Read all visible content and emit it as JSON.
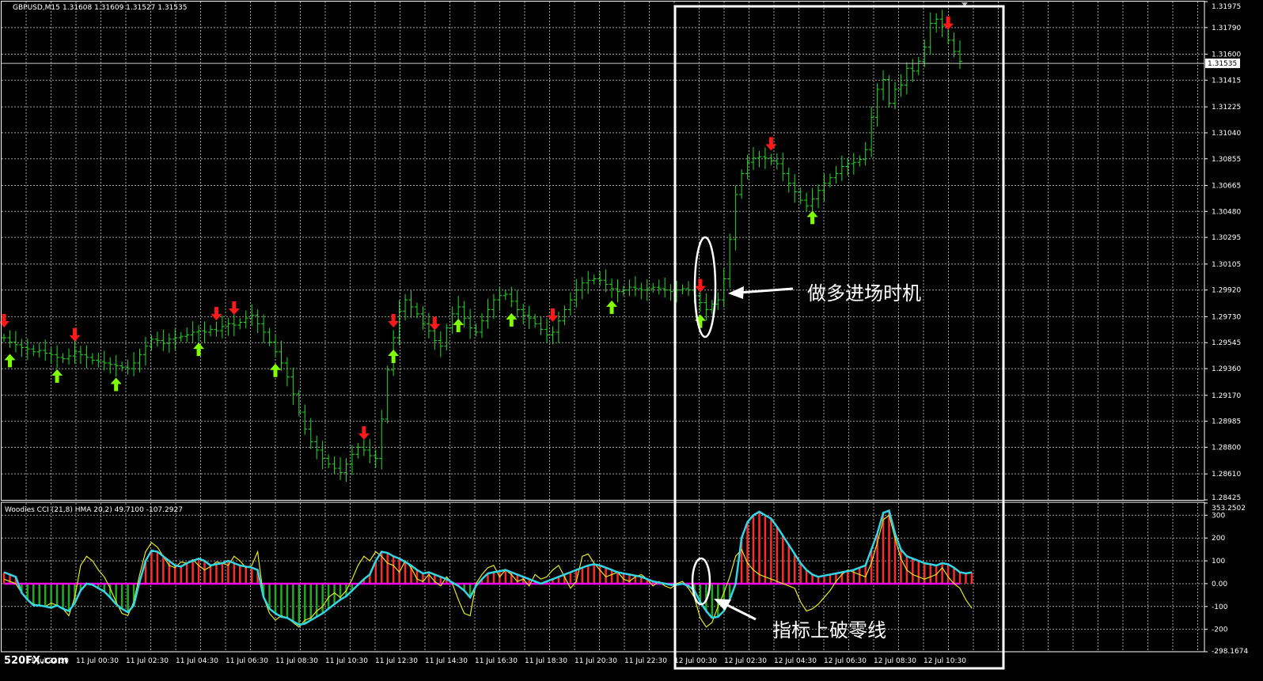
{
  "window": {
    "symbol_label": "GBPUSD,M15",
    "ohlc_label": "1.31608 1.31609 1.31527 1.31535",
    "indicator_label": "Woodies CCI (21,8) HMA 20,2) 49.7100 -107.2927",
    "watermark": "520FX.com"
  },
  "annotations": {
    "long_entry": "做多进场时机",
    "zero_break": "指标上破零线"
  },
  "colors": {
    "background": "#000000",
    "grid": "#a0a0a0",
    "price_bar": "#22dd22",
    "up_arrow": "#7fff00",
    "down_arrow": "#ff1a1a",
    "cci_line": "#33d6e6",
    "turbo_line": "#e6e619",
    "zero_line": "#ff00ff",
    "hist_up": "#ff2a2a",
    "hist_down": "#22aa22",
    "highlight_box": "#ffffff"
  },
  "chart_data": {
    "type": "line",
    "price": {
      "last": "1.31535",
      "ylim": [
        1.28425,
        1.31975
      ],
      "ticks": [
        "1.31975",
        "1.31790",
        "1.31600",
        "1.31415",
        "1.31225",
        "1.31040",
        "1.30855",
        "1.30665",
        "1.30480",
        "1.30295",
        "1.30105",
        "1.29920",
        "1.29730",
        "1.29545",
        "1.29360",
        "1.29170",
        "1.28985",
        "1.28800",
        "1.28610",
        "1.28425"
      ],
      "closes": [
        1.2958,
        1.2955,
        1.2953,
        1.2951,
        1.295,
        1.2948,
        1.2949,
        1.2947,
        1.2946,
        1.2944,
        1.2943,
        1.2945,
        1.2948,
        1.2946,
        1.2944,
        1.2942,
        1.2941,
        1.294,
        1.2939,
        1.2938,
        1.2937,
        1.2936,
        1.294,
        1.2946,
        1.2952,
        1.2957,
        1.2956,
        1.2954,
        1.2957,
        1.2958,
        1.2959,
        1.296,
        1.2962,
        1.2963,
        1.2962,
        1.2964,
        1.2963,
        1.2966,
        1.2968,
        1.2967,
        1.2969,
        1.2972,
        1.2974,
        1.2968,
        1.2962,
        1.2955,
        1.2948,
        1.294,
        1.293,
        1.2918,
        1.2905,
        1.2893,
        1.2884,
        1.2878,
        1.2872,
        1.2868,
        1.2865,
        1.2862,
        1.2868,
        1.2875,
        1.288,
        1.2878,
        1.2874,
        1.2872,
        1.29,
        1.2935,
        1.2958,
        1.2977,
        1.2985,
        1.298,
        1.2975,
        1.2968,
        1.2963,
        1.2956,
        1.2952,
        1.2965,
        1.2975,
        1.298,
        1.2972,
        1.2965,
        1.2962,
        1.297,
        1.2978,
        1.2985,
        1.2988,
        1.2989,
        1.2984,
        1.2978,
        1.2974,
        1.2972,
        1.2968,
        1.2964,
        1.296,
        1.2962,
        1.297,
        1.2978,
        1.2985,
        1.2992,
        1.2997,
        1.2999,
        1.3,
        1.2999,
        1.2996,
        1.2993,
        1.2991,
        1.2992,
        1.2994,
        1.2993,
        1.2992,
        1.2993,
        1.2994,
        1.2993,
        1.2992,
        1.2991,
        1.2992,
        1.2993,
        1.2992,
        1.2988,
        1.2983,
        1.2978,
        1.2982,
        1.2985,
        1.3,
        1.3028,
        1.306,
        1.3075,
        1.3083,
        1.3086,
        1.3087,
        1.3086,
        1.3084,
        1.3082,
        1.3075,
        1.3068,
        1.3062,
        1.3056,
        1.3052,
        1.3057,
        1.3063,
        1.3068,
        1.3072,
        1.3075,
        1.308,
        1.3082,
        1.3083,
        1.3085,
        1.3092,
        1.3115,
        1.3135,
        1.3142,
        1.3125,
        1.3135,
        1.3138,
        1.315,
        1.3148,
        1.3155,
        1.3165,
        1.3182,
        1.3185,
        1.318,
        1.317,
        1.3162,
        1.3155
      ]
    },
    "arrows_up": [
      1,
      9,
      19,
      33,
      46,
      66,
      77,
      86,
      103,
      118,
      137
    ],
    "arrows_down": [
      0,
      12,
      36,
      39,
      61,
      66,
      73,
      93,
      118,
      130,
      160
    ],
    "cci": {
      "ylim": [
        -298.1674,
        353.2502
      ],
      "ticks": [
        "353.2502",
        "300",
        "200",
        "100",
        "0.00",
        "-100",
        "-200",
        "-298.1674"
      ],
      "series": [
        {
          "values": [
            50,
            40,
            30,
            -40,
            -70,
            -95,
            -95,
            -100,
            -105,
            -95,
            -110,
            -120,
            -85,
            -30,
            0,
            -5,
            -20,
            -35,
            -60,
            -90,
            -110,
            -125,
            -95,
            10,
            100,
            145,
            140,
            120,
            100,
            80,
            75,
            90,
            100,
            110,
            100,
            80,
            85,
            90,
            100,
            90,
            80,
            75,
            70,
            60,
            -60,
            -110,
            -130,
            -145,
            -150,
            -165,
            -180,
            -175,
            -160,
            -145,
            -130,
            -110,
            -90,
            -70,
            -55,
            -30,
            -5,
            20,
            40,
            100,
            140,
            135,
            120,
            110,
            95,
            80,
            60,
            45,
            50,
            40,
            30,
            20,
            5,
            -10,
            -30,
            -60,
            -10,
            20,
            45,
            50,
            55,
            60,
            50,
            40,
            30,
            20,
            10,
            0,
            10,
            20,
            30,
            40,
            50,
            60,
            70,
            80,
            85,
            80,
            70,
            60,
            50,
            45,
            40,
            35,
            30,
            20,
            10,
            5,
            0,
            -5,
            -5,
            0,
            -10,
            -30,
            -80,
            -120,
            -150,
            -145,
            -120,
            -70,
            0,
            200,
            270,
            300,
            315,
            300,
            285,
            250,
            210,
            170,
            130,
            90,
            60,
            40,
            30,
            35,
            40,
            45,
            50,
            55,
            60,
            70,
            80,
            150,
            220,
            310,
            320,
            220,
            150,
            120,
            110,
            100,
            90,
            85,
            80,
            90,
            85,
            70,
            50,
            45,
            49.71
          ]
        },
        {
          "values": [
            20,
            10,
            0,
            -40,
            -70,
            -90,
            -95,
            -100,
            -85,
            -95,
            -110,
            -140,
            -60,
            80,
            120,
            100,
            60,
            30,
            -20,
            -80,
            -130,
            -140,
            -80,
            40,
            140,
            180,
            160,
            120,
            80,
            70,
            95,
            90,
            105,
            80,
            60,
            75,
            95,
            90,
            80,
            120,
            100,
            70,
            80,
            140,
            -60,
            -130,
            -160,
            -140,
            -150,
            -170,
            -190,
            -160,
            -150,
            -120,
            -100,
            -60,
            -40,
            -60,
            -30,
            20,
            80,
            120,
            100,
            140,
            120,
            90,
            80,
            50,
            100,
            70,
            20,
            10,
            40,
            10,
            -10,
            30,
            0,
            -70,
            -130,
            -140,
            0,
            40,
            70,
            80,
            30,
            60,
            40,
            10,
            20,
            -10,
            40,
            20,
            30,
            60,
            80,
            30,
            -20,
            10,
            120,
            130,
            90,
            60,
            30,
            40,
            50,
            20,
            10,
            30,
            40,
            20,
            -10,
            10,
            -10,
            -20,
            0,
            10,
            -20,
            -60,
            -150,
            -190,
            -170,
            -100,
            -40,
            30,
            120,
            150,
            90,
            60,
            40,
            30,
            20,
            10,
            0,
            -10,
            -20,
            -80,
            -120,
            -110,
            -90,
            -60,
            -30,
            10,
            40,
            60,
            50,
            40,
            30,
            90,
            180,
            280,
            300,
            200,
            110,
            60,
            40,
            30,
            20,
            30,
            40,
            70,
            30,
            0,
            -20,
            -70,
            -107.29
          ]
        }
      ]
    },
    "time_labels": [
      "11 Jul 22:30",
      "11 Jul 00:30",
      "11 Jul 02:30",
      "11 Jul 04:30",
      "11 Jul 06:30",
      "11 Jul 08:30",
      "11 Jul 10:30",
      "11 Jul 12:30",
      "11 Jul 14:30",
      "11 Jul 16:30",
      "11 Jul 18:30",
      "11 Jul 20:30",
      "11 Jul 22:30",
      "12 Jul 00:30",
      "12 Jul 02:30",
      "12 Jul 04:30",
      "12 Jul 06:30",
      "12 Jul 08:30",
      "12 Jul 10:30"
    ]
  }
}
